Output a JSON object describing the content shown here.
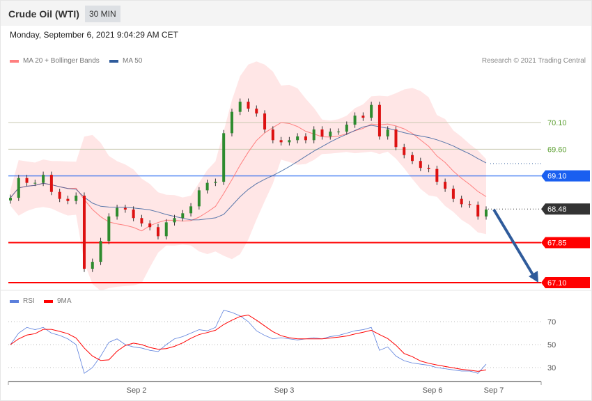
{
  "header": {
    "title": "Crude Oil (WTI)",
    "timeframe": "30 MIN"
  },
  "timestamp": "Monday, September 6, 2021 9:04:29 AM CET",
  "legend": {
    "ma20": "MA 20 + Bollinger Bands",
    "ma50": "MA 50",
    "ma20_color": "#ff7f7f",
    "ma50_color": "#2f5b9b"
  },
  "copyright": "Research © 2021 Trading Central",
  "levels": [
    {
      "value": "70.10",
      "price": 70.1,
      "style": "resistance-line",
      "color": "#5a9e2f"
    },
    {
      "value": "69.60",
      "price": 69.6,
      "style": "resistance-line",
      "color": "#5a9e2f"
    },
    {
      "value": "69.10",
      "price": 69.1,
      "style": "pivot",
      "color": "#1a5ff0"
    },
    {
      "value": "68.48",
      "price": 68.48,
      "style": "last",
      "color": "#333333"
    },
    {
      "value": "67.85",
      "price": 67.85,
      "style": "support",
      "color": "#ff0000"
    },
    {
      "value": "67.10",
      "price": 67.1,
      "style": "support",
      "color": "#ff0000"
    }
  ],
  "rsi_legend": {
    "rsi": "RSI",
    "ma": "9MA",
    "rsi_color": "#5b7fdc",
    "ma_color": "#ff0000"
  },
  "rsi_ticks": [
    "70",
    "50",
    "30"
  ],
  "x_labels": [
    "Sep 2",
    "Sep 3",
    "Sep 6",
    "Sep 7"
  ],
  "chart_data": {
    "type": "candlestick",
    "closes": [
      68.69,
      69.06,
      68.97,
      68.97,
      69.12,
      68.8,
      68.67,
      68.63,
      68.73,
      67.36,
      67.49,
      67.88,
      68.34,
      68.5,
      68.47,
      68.31,
      68.21,
      68.14,
      67.97,
      68.23,
      68.31,
      68.4,
      68.53,
      68.83,
      68.97,
      68.99,
      69.9,
      70.3,
      70.49,
      70.36,
      70.27,
      69.97,
      69.77,
      69.73,
      69.77,
      69.84,
      69.77,
      69.97,
      69.84,
      69.93,
      69.93,
      70.06,
      70.23,
      70.19,
      70.43,
      69.84,
      69.97,
      69.64,
      69.49,
      69.38,
      69.25,
      69.23,
      68.99,
      68.86,
      68.67,
      68.57,
      68.56,
      68.34,
      68.47
    ],
    "rsi": [
      50,
      60,
      65,
      63,
      65,
      60,
      58,
      55,
      50,
      25,
      30,
      40,
      52,
      55,
      50,
      48,
      47,
      45,
      44,
      50,
      55,
      57,
      60,
      63,
      62,
      65,
      80,
      78,
      75,
      70,
      62,
      58,
      55,
      56,
      55,
      54,
      55,
      56,
      55,
      57,
      58,
      60,
      62,
      63,
      65,
      45,
      48,
      40,
      36,
      34,
      33,
      32,
      30,
      29,
      28,
      27,
      27,
      25,
      33
    ],
    "ylim": [
      67.0,
      71.0
    ],
    "rsi_levels": [
      70,
      50,
      30
    ]
  }
}
